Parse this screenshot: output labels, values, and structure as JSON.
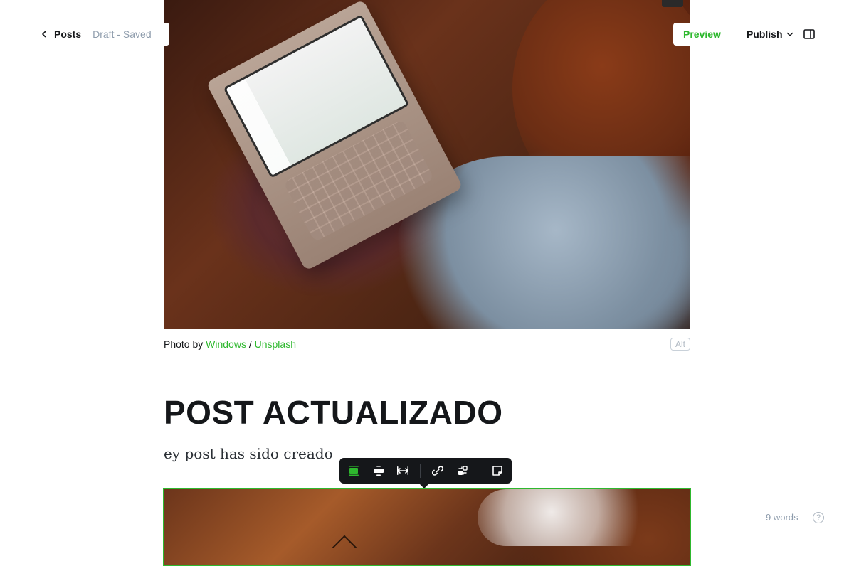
{
  "header": {
    "back_label": "Posts",
    "status": "Draft - Saved",
    "preview_label": "Preview",
    "publish_label": "Publish"
  },
  "image_caption": {
    "prefix": "Photo by ",
    "author": "Windows",
    "separator": " / ",
    "source": "Unsplash",
    "alt_label": "Alt"
  },
  "post": {
    "title": "POST ACTUALIZADO",
    "body": "ey post has sido creado"
  },
  "image_toolbar": {
    "buttons": [
      {
        "name": "image-width-regular-icon",
        "active": true
      },
      {
        "name": "image-width-wide-icon",
        "active": false
      },
      {
        "name": "image-width-full-icon",
        "active": false
      },
      {
        "name": "link-icon",
        "active": false
      },
      {
        "name": "replace-image-icon",
        "active": false
      },
      {
        "name": "snippet-icon",
        "active": false
      }
    ],
    "accent_color": "#2eb82e"
  },
  "footer": {
    "word_count": "9 words",
    "help_symbol": "?"
  }
}
